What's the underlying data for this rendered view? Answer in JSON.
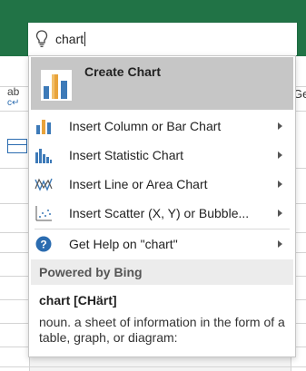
{
  "search": {
    "query": "chart",
    "icon": "lightbulb-icon"
  },
  "background": {
    "ribbon_color": "#217346",
    "left_label_top": "ab",
    "left_label_bottom": "c",
    "right_label": "Ge"
  },
  "menu": {
    "primary": {
      "label": "Create Chart",
      "icon": "create-chart-icon"
    },
    "items": [
      {
        "label": "Insert Column or Bar Chart",
        "icon": "column-chart-icon",
        "has_submenu": true
      },
      {
        "label": "Insert Statistic Chart",
        "icon": "statistic-chart-icon",
        "has_submenu": true
      },
      {
        "label": "Insert Line or Area Chart",
        "icon": "line-chart-icon",
        "has_submenu": true
      },
      {
        "label": "Insert Scatter (X, Y) or Bubble...",
        "icon": "scatter-chart-icon",
        "has_submenu": true
      },
      {
        "label": "Get Help on \"chart\"",
        "icon": "help-icon",
        "has_submenu": true
      }
    ]
  },
  "bing": {
    "header": "Powered by Bing",
    "word": "chart [CHärt]",
    "definition": "noun. a sheet of information in the form of a table, graph, or diagram:"
  }
}
